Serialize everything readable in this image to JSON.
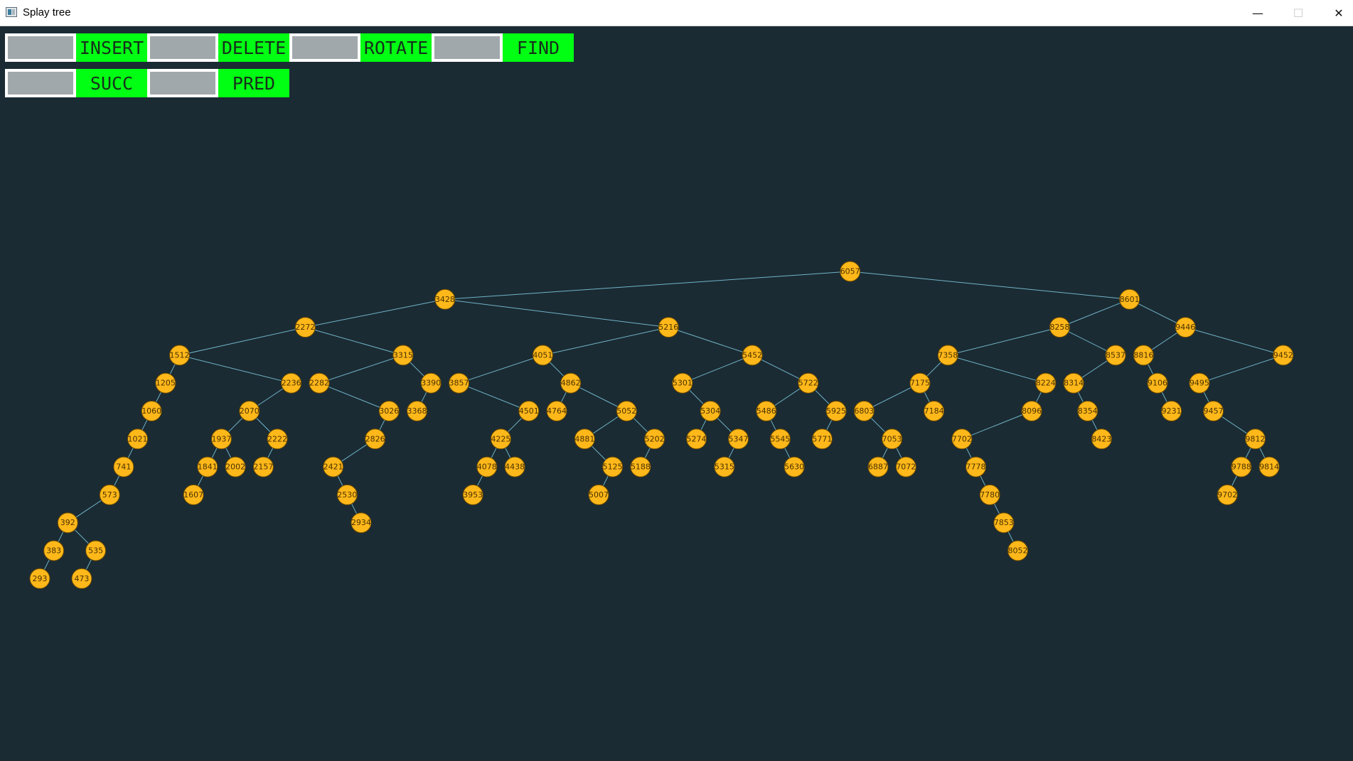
{
  "window": {
    "title": "Splay tree",
    "minimize_glyph": "—",
    "maximize_glyph": "☐",
    "close_glyph": "✕"
  },
  "toolbar": {
    "insert_label": "INSERT",
    "delete_label": "DELETE",
    "rotate_label": "ROTATE",
    "find_label": "FIND",
    "succ_label": "SUCC",
    "pred_label": "PRED",
    "insert_value": "",
    "delete_value": "",
    "rotate_value": "",
    "find_value": "",
    "succ_value": "",
    "pred_value": ""
  },
  "colors": {
    "background": "#1b2b33",
    "button": "#00ff12",
    "node": "#ffb81a",
    "edge": "#6fb3c8",
    "input": "#a1a8ac"
  },
  "tree": {
    "key": "6057",
    "left": {
      "key": "3428",
      "left": {
        "key": "2272",
        "left": {
          "key": "1512",
          "left": {
            "key": "1205",
            "left": {
              "key": "1060",
              "left": {
                "key": "1021",
                "left": {
                  "key": "741",
                  "left": {
                    "key": "573",
                    "left": {
                      "key": "392",
                      "left": {
                        "key": "383",
                        "left": {
                          "key": "293"
                        }
                      },
                      "right": {
                        "key": "535",
                        "left": {
                          "key": "473"
                        }
                      }
                    }
                  }
                }
              }
            }
          },
          "right": {
            "key": "2236",
            "left": {
              "key": "2070",
              "left": {
                "key": "1937",
                "left": {
                  "key": "1841",
                  "left": {
                    "key": "1607"
                  }
                },
                "right": {
                  "key": "2002"
                }
              },
              "right": {
                "key": "2222",
                "left": {
                  "key": "2157"
                }
              }
            }
          }
        },
        "right": {
          "key": "3315",
          "left": {
            "key": "2282",
            "right": {
              "key": "3026",
              "left": {
                "key": "2826",
                "left": {
                  "key": "2421",
                  "right": {
                    "key": "2530",
                    "right": {
                      "key": "2934"
                    }
                  }
                }
              }
            }
          },
          "right": {
            "key": "3390",
            "left": {
              "key": "3368"
            }
          }
        }
      },
      "right": {
        "key": "5216",
        "left": {
          "key": "4051",
          "left": {
            "key": "3857",
            "right": {
              "key": "4501",
              "left": {
                "key": "4225",
                "left": {
                  "key": "4078",
                  "left": {
                    "key": "3953"
                  }
                },
                "right": {
                  "key": "4438"
                }
              }
            }
          },
          "right": {
            "key": "4862",
            "left": {
              "key": "4764"
            },
            "right": {
              "key": "5052",
              "left": {
                "key": "4881",
                "right": {
                  "key": "5125",
                  "left": {
                    "key": "5007"
                  }
                }
              },
              "right": {
                "key": "5202",
                "left": {
                  "key": "5188"
                }
              }
            }
          }
        },
        "right": {
          "key": "5452",
          "left": {
            "key": "5301",
            "right": {
              "key": "5304",
              "left": {
                "key": "5274"
              },
              "right": {
                "key": "5347",
                "left": {
                  "key": "5315"
                }
              }
            }
          },
          "right": {
            "key": "5722",
            "left": {
              "key": "5486",
              "right": {
                "key": "5545",
                "right": {
                  "key": "5630"
                }
              }
            },
            "right": {
              "key": "5925",
              "left": {
                "key": "5771"
              }
            }
          }
        }
      }
    },
    "right": {
      "key": "8601",
      "left": {
        "key": "8258",
        "left": {
          "key": "7358",
          "left": {
            "key": "7175",
            "left": {
              "key": "6803",
              "right": {
                "key": "7053",
                "left": {
                  "key": "6887"
                },
                "right": {
                  "key": "7072"
                }
              }
            },
            "right": {
              "key": "7184"
            }
          },
          "right": {
            "key": "8224",
            "left": {
              "key": "8096",
              "left": {
                "key": "7702",
                "right": {
                  "key": "7778",
                  "right": {
                    "key": "7780",
                    "right": {
                      "key": "7853",
                      "right": {
                        "key": "8052"
                      }
                    }
                  }
                }
              }
            }
          }
        },
        "right": {
          "key": "8537",
          "left": {
            "key": "8314",
            "right": {
              "key": "8354",
              "right": {
                "key": "8423"
              }
            }
          }
        }
      },
      "right": {
        "key": "9446",
        "left": {
          "key": "8816",
          "right": {
            "key": "9106",
            "right": {
              "key": "9231"
            }
          }
        },
        "right": {
          "key": "9452",
          "left": {
            "key": "9495",
            "right": {
              "key": "9457",
              "right": {
                "key": "9812",
                "left": {
                  "key": "9788",
                  "left": {
                    "key": "9702"
                  }
                },
                "right": {
                  "key": "9814"
                }
              }
            }
          }
        }
      }
    }
  }
}
